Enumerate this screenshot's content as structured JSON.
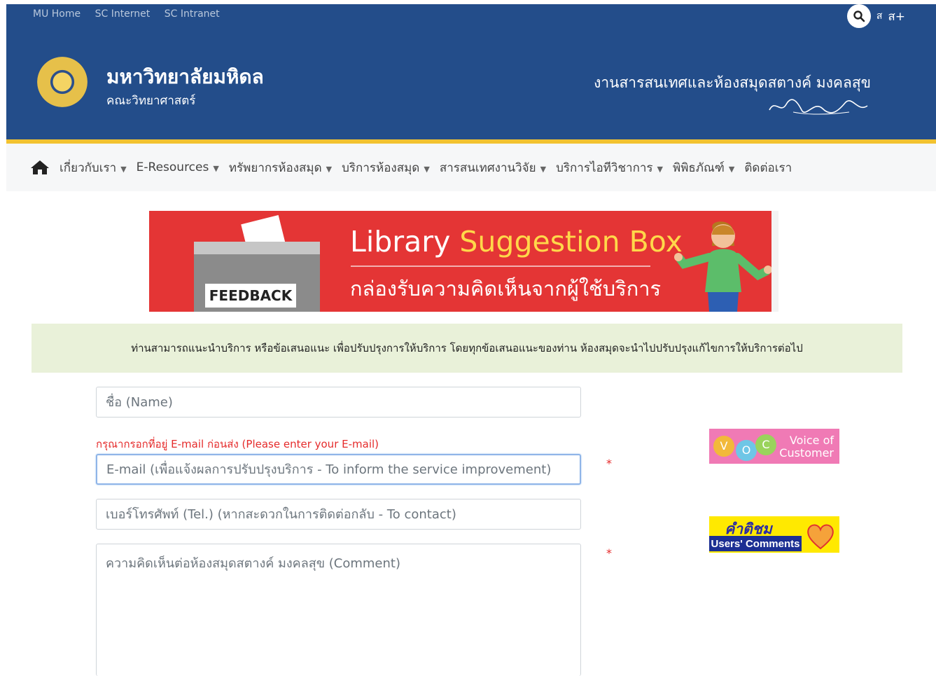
{
  "topbar": {
    "links": [
      "MU Home",
      "SC Internet",
      "SC Intranet"
    ],
    "font_small": "ส",
    "font_large": "ส+",
    "search_icon": "search-icon"
  },
  "header": {
    "university": "มหาวิทยาลัยมหิดล",
    "faculty": "คณะวิทยาศาสตร์",
    "department": "งานสารสนเทศและห้องสมุดสตางค์ มงคลสุข",
    "logo": "mahidol-seal-logo",
    "signature": "signature-image"
  },
  "nav": {
    "home_icon": "home-icon",
    "items": [
      {
        "label": "เกี่ยวกับเรา",
        "dropdown": true
      },
      {
        "label": "E-Resources",
        "dropdown": true
      },
      {
        "label": "ทรัพยากรห้องสมุด",
        "dropdown": true
      },
      {
        "label": "บริการห้องสมุด",
        "dropdown": true
      },
      {
        "label": "สารสนเทศงานวิจัย",
        "dropdown": true
      },
      {
        "label": "บริการไอทีวิชาการ",
        "dropdown": true
      },
      {
        "label": "พิพิธภัณฑ์",
        "dropdown": true
      },
      {
        "label": "ติดต่อเรา",
        "dropdown": false
      }
    ],
    "caret": "▼"
  },
  "banner": {
    "feedback_label": "FEEDBACK",
    "title_part1": "Library ",
    "title_part2": "Suggestion Box",
    "subtitle": "กล่องรับความคิดเห็นจากผู้ใช้บริการ"
  },
  "notice": "ท่านสามารถแนะนำบริการ หรือข้อเสนอแนะ เพื่อปรับปรุงการให้บริการ โดยทุกข้อเสนอแนะของท่าน ห้องสมุดจะนำไปปรับปรุงแก้ไขการให้บริการต่อไป",
  "form": {
    "name_placeholder": "ชื่อ (Name)",
    "email_warning": "กรุณากรอกที่อยู่ E-mail ก่อนส่ง (Please enter your E-mail)",
    "email_placeholder": "E-mail (เพื่อแจ้งผลการปรับปรุงบริการ - To inform the service improvement)",
    "phone_placeholder": "เบอร์โทรศัพท์ (Tel.) (หากสะดวกในการติดต่อกลับ - To contact)",
    "comment_placeholder": "ความคิดเห็นต่อห้องสมุดสตางค์ มงคลสุข (Comment)",
    "required_mark": "*"
  },
  "sidebar": {
    "voc_letters": [
      "V",
      "O",
      "C"
    ],
    "voc_line1": "Voice of",
    "voc_line2": "Customer",
    "comments_th": "คำติชม",
    "comments_en": "Users' Comments"
  },
  "colors": {
    "header_bg": "#234d8a",
    "accent_line": "#f2c230",
    "banner_red": "#e43535",
    "notice_bg": "#e9f1d9",
    "required_red": "#e52b2b"
  }
}
